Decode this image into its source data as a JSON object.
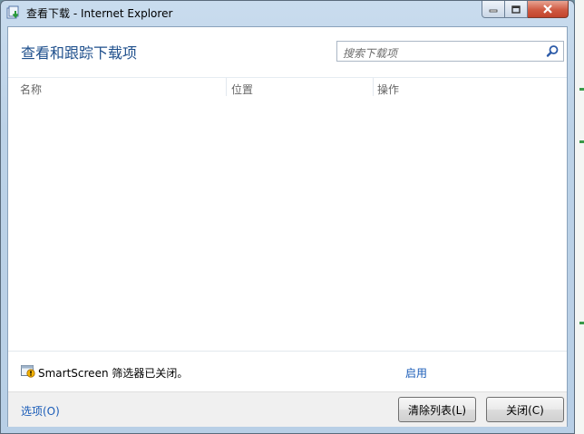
{
  "window": {
    "title": "查看下载 - Internet Explorer"
  },
  "header": {
    "heading": "查看和跟踪下载项",
    "search_placeholder": "搜索下载项"
  },
  "list": {
    "columns": [
      "名称",
      "位置",
      "操作"
    ]
  },
  "smartscreen": {
    "status_text": "SmartScreen 筛选器已关闭。",
    "enable_link": "启用"
  },
  "footer": {
    "options_link": "选项(O)",
    "clear_list_label": "清除列表(L)",
    "close_label": "关闭(C)"
  },
  "colors": {
    "accent_link": "#1a5cb8",
    "heading": "#1e4f8c",
    "close_button": "#c2442c"
  }
}
